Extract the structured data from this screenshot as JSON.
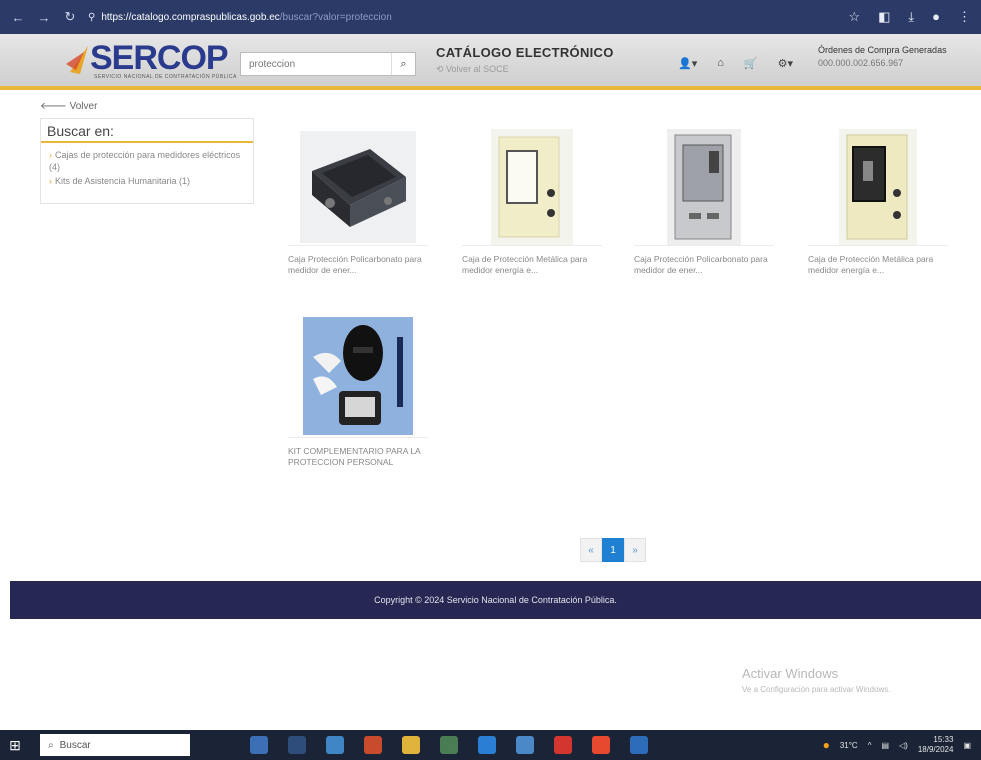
{
  "browser": {
    "url_host": "https://catalogo.compraspublicas.gob.ec",
    "url_path": "/buscar?valor=proteccion"
  },
  "header": {
    "logo_text": "SERCOP",
    "logo_subtext": "SERVICIO NACIONAL DE CONTRATACIÓN PÚBLICA",
    "search_value": "proteccion",
    "catalog_title": "CATÁLOGO ELECTRÓNICO",
    "catalog_back": "Volver al SOCE",
    "orders_label": "Órdenes de Compra Generadas",
    "orders_value": "000.000.002.656.967"
  },
  "main": {
    "back_label": "Volver",
    "sidebar": {
      "title": "Buscar en:",
      "items": [
        {
          "label": "Cajas de protección para medidores eléctricos (4)"
        },
        {
          "label": "Kits de Asistencia Humanitaria (1)"
        }
      ]
    },
    "products": [
      {
        "name": "Caja Protección Policarbonato para medidor de ener...",
        "image": "black-polycarbonate-box"
      },
      {
        "name": "Caja de Protección Metálica para medidor energía e...",
        "image": "cream-metal-box"
      },
      {
        "name": "Caja Protección Policarbonato para medidor de ener...",
        "image": "clear-polycarbonate-box"
      },
      {
        "name": "Caja de Protección Metálica para medidor energía e...",
        "image": "cream-metal-box-2"
      },
      {
        "name": "KIT COMPLEMENTARIO PARA LA PROTECCION PERSONAL",
        "image": "protection-kit"
      }
    ],
    "pager": {
      "prev": "«",
      "current": "1",
      "next": "»"
    }
  },
  "footer": {
    "text": "Copyright © 2024 Servicio Nacional de Contratación Pública."
  },
  "overlay": {
    "activate_title": "Activar Windows",
    "activate_sub": "Ve a Configuración para activar Windows."
  },
  "taskbar": {
    "search_label": "Buscar",
    "temperature": "31°C",
    "time": "15:33",
    "date": "18/9/2024"
  },
  "colors": {
    "header_accent": "#e8b73a",
    "footer_bg": "#262752",
    "logo_blue": "#2a3a8c",
    "pager_active": "#1f7fd0"
  }
}
